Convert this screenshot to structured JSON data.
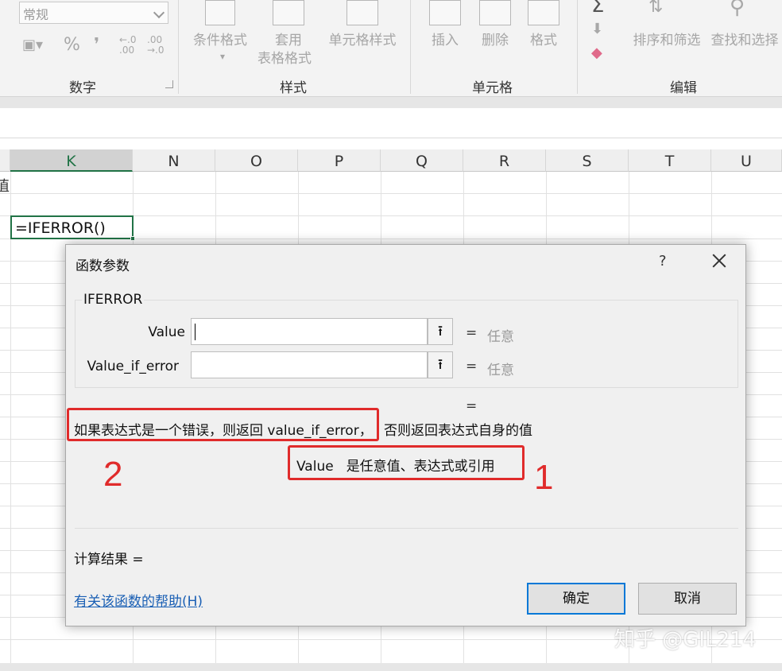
{
  "ribbon": {
    "number_format_value": "常规",
    "percent_symbol": "%",
    "comma_symbol": "❜",
    "dec_increase": "←.0 .00",
    "dec_decrease": ".00 →.0",
    "group_number": "数字",
    "conditional_format": "条件格式",
    "table_format_1": "套用",
    "table_format_2": "表格格式",
    "cell_styles": "单元格样式",
    "group_styles": "样式",
    "insert": "插入",
    "delete": "删除",
    "format": "格式",
    "group_cells": "单元格",
    "sort_filter": "排序和筛选",
    "find_select": "查找和选择",
    "group_editing": "编辑"
  },
  "sheet": {
    "columns": [
      "K",
      "N",
      "O",
      "P",
      "Q",
      "R",
      "S",
      "T",
      "U"
    ],
    "selected_column": "K",
    "active_cell_formula": "=IFERROR()",
    "left_partial_char": "值"
  },
  "dialog": {
    "title": "函数参数",
    "help_symbol": "?",
    "function_name": "IFERROR",
    "args": [
      {
        "label": "Value",
        "equals": "=",
        "hint": "任意"
      },
      {
        "label": "Value_if_error",
        "equals": "=",
        "hint": "任意"
      }
    ],
    "pick_symbol": "⭱",
    "result_equals": "=",
    "description_highlight": "如果表达式是一个错误，则返回 value_if_error，",
    "description_rest": "否则返回表达式自身的值",
    "param_name": "Value",
    "param_desc": "是任意值、表达式或引用",
    "result_label": "计算结果 =",
    "help_link": "有关该函数的帮助(H)",
    "ok": "确定",
    "cancel": "取消"
  },
  "annotations": {
    "num1": "1",
    "num2": "2",
    "color": "#e02b2b"
  },
  "watermark": "知乎 @GIL214"
}
